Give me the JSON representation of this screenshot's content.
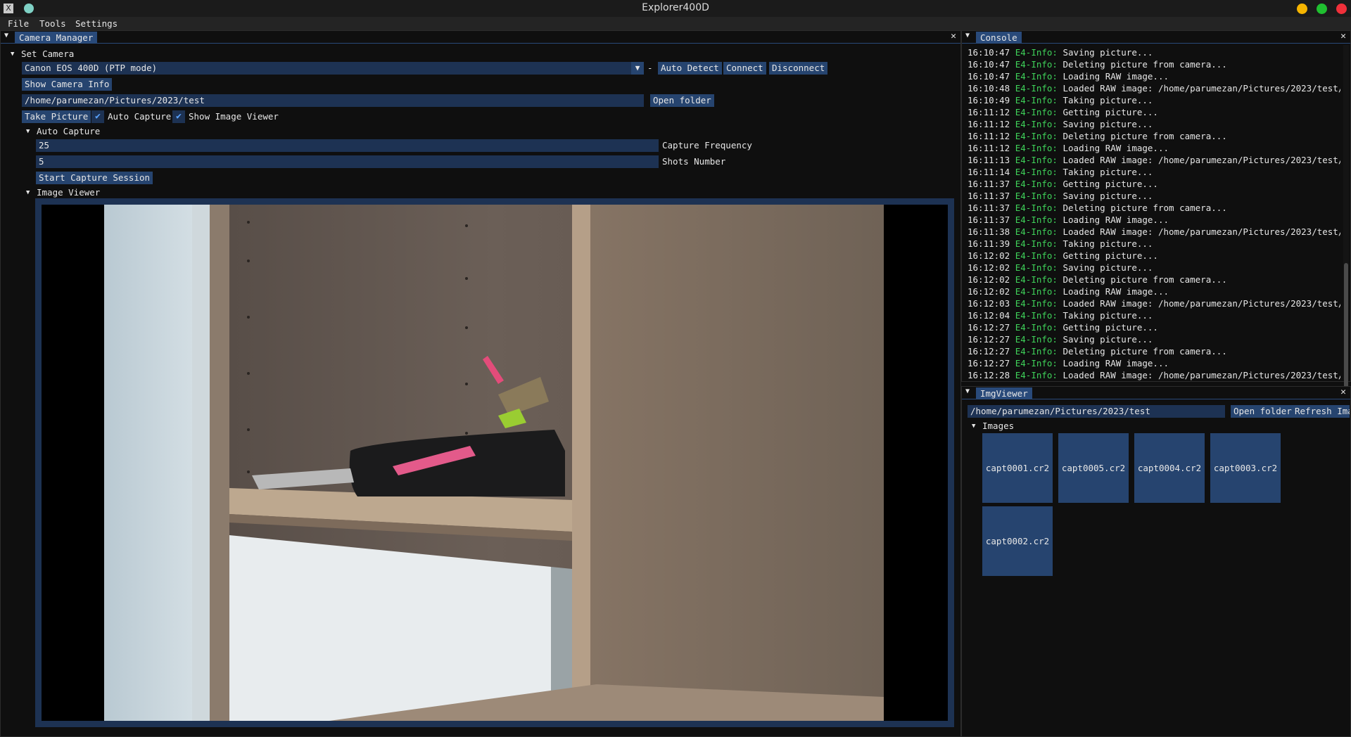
{
  "window": {
    "title": "Explorer400D",
    "app_icon": "X"
  },
  "menu": {
    "items": [
      "File",
      "Tools",
      "Settings"
    ]
  },
  "camera_manager": {
    "tab_title": "Camera Manager",
    "set_camera_label": "Set Camera",
    "camera_select_value": "Canon EOS 400D (PTP mode)",
    "dash": "-",
    "auto_detect": "Auto Detect",
    "connect": "Connect",
    "disconnect": "Disconnect",
    "show_camera_info": "Show Camera Info",
    "path_value": "/home/parumezan/Pictures/2023/test",
    "open_folder": "Open folder",
    "take_picture": "Take Picture",
    "auto_capture_check": "Auto Capture",
    "show_image_viewer_check": "Show Image Viewer",
    "auto_capture_section": "Auto Capture",
    "capture_frequency_value": "25",
    "capture_frequency_label": "Capture Frequency",
    "shots_number_value": "5",
    "shots_number_label": "Shots Number",
    "start_session": "Start Capture Session",
    "image_viewer_section": "Image Viewer"
  },
  "console": {
    "tab_title": "Console",
    "lines": [
      {
        "time": "16:10:47",
        "level": "E4-Info:",
        "msg": "Saving picture..."
      },
      {
        "time": "16:10:47",
        "level": "E4-Info:",
        "msg": "Deleting picture from camera..."
      },
      {
        "time": "16:10:47",
        "level": "E4-Info:",
        "msg": "Loading RAW image..."
      },
      {
        "time": "16:10:48",
        "level": "E4-Info:",
        "msg": "Loaded RAW image: /home/parumezan/Pictures/2023/test/capt"
      },
      {
        "time": "16:10:49",
        "level": "E4-Info:",
        "msg": "Taking picture..."
      },
      {
        "time": "16:11:12",
        "level": "E4-Info:",
        "msg": "Getting picture..."
      },
      {
        "time": "16:11:12",
        "level": "E4-Info:",
        "msg": "Saving picture..."
      },
      {
        "time": "16:11:12",
        "level": "E4-Info:",
        "msg": "Deleting picture from camera..."
      },
      {
        "time": "16:11:12",
        "level": "E4-Info:",
        "msg": "Loading RAW image..."
      },
      {
        "time": "16:11:13",
        "level": "E4-Info:",
        "msg": "Loaded RAW image: /home/parumezan/Pictures/2023/test/capt"
      },
      {
        "time": "16:11:14",
        "level": "E4-Info:",
        "msg": "Taking picture..."
      },
      {
        "time": "16:11:37",
        "level": "E4-Info:",
        "msg": "Getting picture..."
      },
      {
        "time": "16:11:37",
        "level": "E4-Info:",
        "msg": "Saving picture..."
      },
      {
        "time": "16:11:37",
        "level": "E4-Info:",
        "msg": "Deleting picture from camera..."
      },
      {
        "time": "16:11:37",
        "level": "E4-Info:",
        "msg": "Loading RAW image..."
      },
      {
        "time": "16:11:38",
        "level": "E4-Info:",
        "msg": "Loaded RAW image: /home/parumezan/Pictures/2023/test/capt"
      },
      {
        "time": "16:11:39",
        "level": "E4-Info:",
        "msg": "Taking picture..."
      },
      {
        "time": "16:12:02",
        "level": "E4-Info:",
        "msg": "Getting picture..."
      },
      {
        "time": "16:12:02",
        "level": "E4-Info:",
        "msg": "Saving picture..."
      },
      {
        "time": "16:12:02",
        "level": "E4-Info:",
        "msg": "Deleting picture from camera..."
      },
      {
        "time": "16:12:02",
        "level": "E4-Info:",
        "msg": "Loading RAW image..."
      },
      {
        "time": "16:12:03",
        "level": "E4-Info:",
        "msg": "Loaded RAW image: /home/parumezan/Pictures/2023/test/capt"
      },
      {
        "time": "16:12:04",
        "level": "E4-Info:",
        "msg": "Taking picture..."
      },
      {
        "time": "16:12:27",
        "level": "E4-Info:",
        "msg": "Getting picture..."
      },
      {
        "time": "16:12:27",
        "level": "E4-Info:",
        "msg": "Saving picture..."
      },
      {
        "time": "16:12:27",
        "level": "E4-Info:",
        "msg": "Deleting picture from camera..."
      },
      {
        "time": "16:12:27",
        "level": "E4-Info:",
        "msg": "Loading RAW image..."
      },
      {
        "time": "16:12:28",
        "level": "E4-Info:",
        "msg": "Loaded RAW image: /home/parumezan/Pictures/2023/test/capt"
      }
    ]
  },
  "img_viewer": {
    "tab_title": "ImgViewer",
    "path_value": "/home/parumezan/Pictures/2023/test",
    "open_folder": "Open folder",
    "refresh": "Refresh Ima",
    "images_section": "Images",
    "thumbnails": [
      "capt0001.cr2",
      "capt0005.cr2",
      "capt0004.cr2",
      "capt0003.cr2",
      "capt0002.cr2"
    ]
  },
  "colors": {
    "accent": "#294a7a",
    "button": "#26446f",
    "field": "#1d3253",
    "log_level": "#3fd35a"
  }
}
